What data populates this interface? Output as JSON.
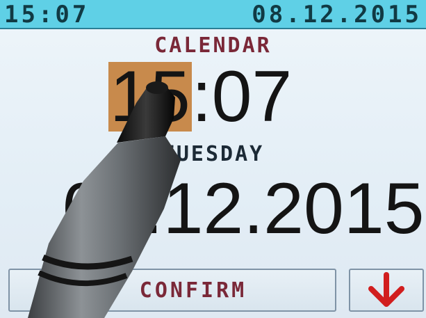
{
  "status_bar": {
    "time": "15:07",
    "date": "08.12.2015"
  },
  "screen_title": "CALENDAR",
  "time": {
    "hours": "15",
    "separator": ":",
    "minutes": "07"
  },
  "weekday": "TUESDAY",
  "date": "08.12.2015",
  "buttons": {
    "confirm_label": "CONFIRM",
    "down_icon": "arrow-down-icon"
  },
  "colors": {
    "status_bar_bg": "#5fd0e6",
    "title_text": "#7a2838",
    "selected_field_bg": "#c88a4c",
    "arrow": "#d11e1e"
  }
}
